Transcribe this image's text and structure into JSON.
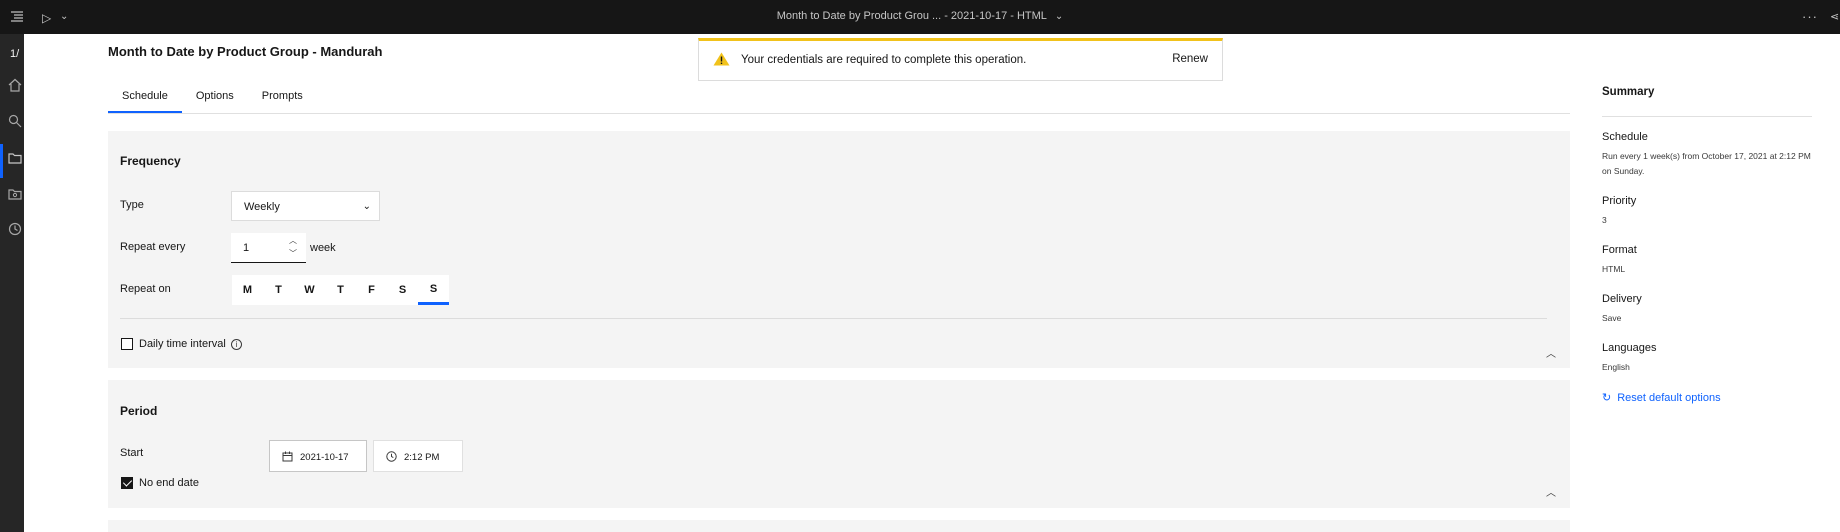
{
  "app": {
    "window_title": "Month to Date by Product Grou ... - 2021-10-17 - HTML",
    "page_counter": "1/"
  },
  "header": {
    "title": "Month to Date by Product Group - Mandurah"
  },
  "tabs": [
    {
      "label": "Schedule",
      "active": true
    },
    {
      "label": "Options",
      "active": false
    },
    {
      "label": "Prompts",
      "active": false
    }
  ],
  "notification": {
    "message": "Your credentials are required to complete this operation.",
    "action": "Renew",
    "kind": "warning",
    "accent_color": "#f1c21b"
  },
  "frequency": {
    "title": "Frequency",
    "type_label": "Type",
    "type_value": "Weekly",
    "repeat_every_label": "Repeat every",
    "repeat_every_value": "1",
    "repeat_unit": "week",
    "repeat_on_label": "Repeat on",
    "days": [
      {
        "label": "M",
        "selected": false
      },
      {
        "label": "T",
        "selected": false
      },
      {
        "label": "W",
        "selected": false
      },
      {
        "label": "T",
        "selected": false
      },
      {
        "label": "F",
        "selected": false
      },
      {
        "label": "S",
        "selected": false
      },
      {
        "label": "S",
        "selected": true
      }
    ],
    "daily_interval_label": "Daily time interval",
    "daily_interval_checked": false
  },
  "period": {
    "title": "Period",
    "start_label": "Start",
    "start_date": "2021-10-17",
    "start_time": "2:12 PM",
    "no_end_date_label": "No end date",
    "no_end_date_checked": true
  },
  "summary": {
    "title": "Summary",
    "items": [
      {
        "label": "Schedule",
        "value": "Run every 1 week(s) from October 17, 2021 at 2:12 PM on Sunday."
      },
      {
        "label": "Priority",
        "value": "3"
      },
      {
        "label": "Format",
        "value": "HTML"
      },
      {
        "label": "Delivery",
        "value": "Save"
      },
      {
        "label": "Languages",
        "value": "English"
      }
    ],
    "reset_label": "Reset default options"
  },
  "colors": {
    "accent": "#0f62fe",
    "topbar": "#161616",
    "panel": "#f4f4f4"
  }
}
